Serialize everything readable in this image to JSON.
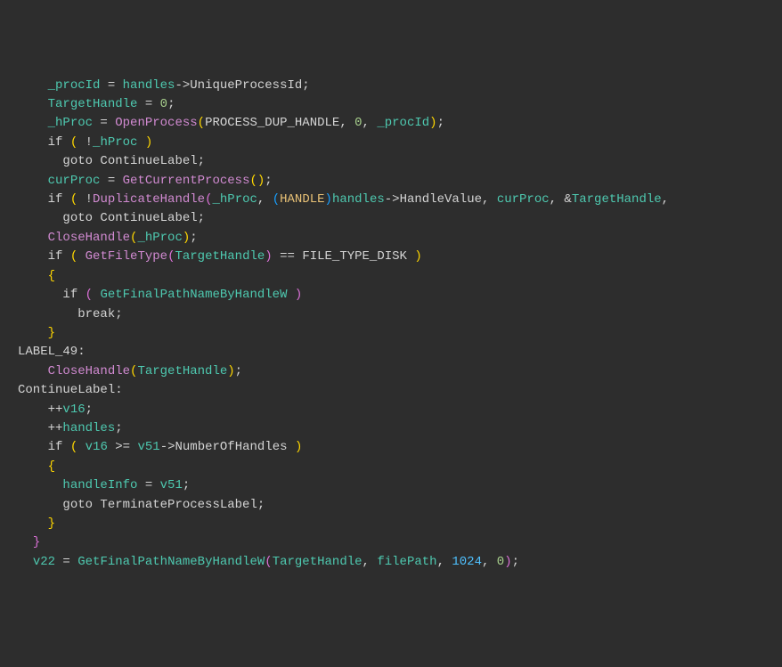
{
  "lines": [
    {
      "ln": "",
      "tokens": [
        [
          "    ",
          "punct"
        ],
        [
          "_procId",
          "var-teal"
        ],
        [
          " = ",
          "punct"
        ],
        [
          "handles",
          "var-teal"
        ],
        [
          "->",
          "punct"
        ],
        [
          "UniqueProcessId",
          ""
        ],
        [
          ";",
          "punct"
        ]
      ]
    },
    {
      "ln": "",
      "tokens": [
        [
          "    ",
          "punct"
        ],
        [
          "TargetHandle",
          "var-teal"
        ],
        [
          " = ",
          "punct"
        ],
        [
          "0",
          "num"
        ],
        [
          ";",
          "punct"
        ]
      ]
    },
    {
      "ln": "",
      "tokens": [
        [
          "    ",
          "punct"
        ],
        [
          "_hProc",
          "var-teal"
        ],
        [
          " = ",
          "punct"
        ],
        [
          "OpenProcess",
          "fn-magenta"
        ],
        [
          "(",
          "bracket-y"
        ],
        [
          "PROCESS_DUP_HANDLE",
          ""
        ],
        [
          ", ",
          "punct"
        ],
        [
          "0",
          "num"
        ],
        [
          ", ",
          "punct"
        ],
        [
          "_procId",
          "var-teal"
        ],
        [
          ")",
          "bracket-y"
        ],
        [
          ";",
          "punct"
        ]
      ]
    },
    {
      "ln": "",
      "tokens": [
        [
          "    ",
          "punct"
        ],
        [
          "if",
          "punct"
        ],
        [
          " ",
          "punct"
        ],
        [
          "(",
          "bracket-y"
        ],
        [
          " !",
          "punct"
        ],
        [
          "_hProc",
          "var-teal"
        ],
        [
          " ",
          "punct"
        ],
        [
          ")",
          "bracket-y"
        ]
      ]
    },
    {
      "ln": "",
      "tokens": [
        [
          "      ",
          "punct"
        ],
        [
          "goto",
          "punct"
        ],
        [
          " ContinueLabel;",
          "punct"
        ]
      ]
    },
    {
      "ln": "",
      "tokens": [
        [
          "    ",
          "punct"
        ],
        [
          "curProc",
          "var-teal"
        ],
        [
          " = ",
          "punct"
        ],
        [
          "GetCurrentProcess",
          "fn-magenta"
        ],
        [
          "(",
          "bracket-y"
        ],
        [
          ")",
          "bracket-y"
        ],
        [
          ";",
          "punct"
        ]
      ]
    },
    {
      "ln": "",
      "tokens": [
        [
          "    ",
          "punct"
        ],
        [
          "if",
          "punct"
        ],
        [
          " ",
          "punct"
        ],
        [
          "(",
          "bracket-y"
        ],
        [
          " !",
          "punct"
        ],
        [
          "DuplicateHandle",
          "fn-magenta"
        ],
        [
          "(",
          "bracket-p"
        ],
        [
          "_hProc",
          "var-teal"
        ],
        [
          ", ",
          "punct"
        ],
        [
          "(",
          "bracket-b"
        ],
        [
          "HANDLE",
          "var-orange"
        ],
        [
          ")",
          "bracket-b"
        ],
        [
          "handles",
          "var-teal"
        ],
        [
          "->",
          "punct"
        ],
        [
          "HandleValue",
          ""
        ],
        [
          ", ",
          "punct"
        ],
        [
          "curProc",
          "var-teal"
        ],
        [
          ", &",
          "punct"
        ],
        [
          "TargetHandle",
          "var-teal"
        ],
        [
          ",",
          "punct"
        ]
      ]
    },
    {
      "ln": "",
      "tokens": [
        [
          "      ",
          "punct"
        ],
        [
          "goto",
          "punct"
        ],
        [
          " ContinueLabel;",
          "punct"
        ]
      ]
    },
    {
      "ln": "",
      "tokens": [
        [
          "    ",
          "punct"
        ],
        [
          "CloseHandle",
          "fn-magenta"
        ],
        [
          "(",
          "bracket-y"
        ],
        [
          "_hProc",
          "var-teal"
        ],
        [
          ")",
          "bracket-y"
        ],
        [
          ";",
          "punct"
        ]
      ]
    },
    {
      "ln": "",
      "tokens": [
        [
          "    ",
          "punct"
        ],
        [
          "if",
          "punct"
        ],
        [
          " ",
          "punct"
        ],
        [
          "(",
          "bracket-y"
        ],
        [
          " ",
          "punct"
        ],
        [
          "GetFileType",
          "fn-magenta"
        ],
        [
          "(",
          "bracket-p"
        ],
        [
          "TargetHandle",
          "var-teal"
        ],
        [
          ")",
          "bracket-p"
        ],
        [
          " == ",
          "punct"
        ],
        [
          "FILE_TYPE_DISK",
          ""
        ],
        [
          " ",
          "punct"
        ],
        [
          ")",
          "bracket-y"
        ]
      ]
    },
    {
      "ln": "",
      "tokens": [
        [
          "    ",
          "punct"
        ],
        [
          "{",
          "bracket-y"
        ]
      ]
    },
    {
      "ln": "",
      "tokens": [
        [
          "      ",
          "punct"
        ],
        [
          "if",
          "punct"
        ],
        [
          " ",
          "punct"
        ],
        [
          "(",
          "bracket-p"
        ],
        [
          " ",
          "punct"
        ],
        [
          "GetFinalPathNameByHandleW",
          "var-teal"
        ],
        [
          " ",
          "punct"
        ],
        [
          ")",
          "bracket-p"
        ]
      ]
    },
    {
      "ln": "",
      "tokens": [
        [
          "        ",
          "punct"
        ],
        [
          "break",
          "punct"
        ],
        [
          ";",
          "punct"
        ]
      ]
    },
    {
      "ln": "",
      "tokens": [
        [
          "    ",
          "punct"
        ],
        [
          "}",
          "bracket-y"
        ]
      ]
    },
    {
      "ln": "",
      "tokens": [
        [
          "LABEL_49:",
          "punct"
        ]
      ]
    },
    {
      "ln": "",
      "tokens": [
        [
          "    ",
          "punct"
        ],
        [
          "CloseHandle",
          "fn-magenta"
        ],
        [
          "(",
          "bracket-y"
        ],
        [
          "TargetHandle",
          "var-teal"
        ],
        [
          ")",
          "bracket-y"
        ],
        [
          ";",
          "punct"
        ]
      ]
    },
    {
      "ln": "",
      "tokens": [
        [
          "ContinueLabel:",
          "punct"
        ]
      ]
    },
    {
      "ln": "",
      "tokens": [
        [
          "    ++",
          "punct"
        ],
        [
          "v16",
          "var-teal"
        ],
        [
          ";",
          "punct"
        ]
      ]
    },
    {
      "ln": "",
      "tokens": [
        [
          "    ++",
          "punct"
        ],
        [
          "handles",
          "var-teal"
        ],
        [
          ";",
          "punct"
        ]
      ]
    },
    {
      "ln": "",
      "tokens": [
        [
          "    ",
          "punct"
        ],
        [
          "if",
          "punct"
        ],
        [
          " ",
          "punct"
        ],
        [
          "(",
          "bracket-y"
        ],
        [
          " ",
          "punct"
        ],
        [
          "v16",
          "var-teal"
        ],
        [
          " >= ",
          "punct"
        ],
        [
          "v51",
          "var-teal"
        ],
        [
          "->",
          "punct"
        ],
        [
          "NumberOfHandles",
          ""
        ],
        [
          " ",
          "punct"
        ],
        [
          ")",
          "bracket-y"
        ]
      ]
    },
    {
      "ln": "",
      "tokens": [
        [
          "    ",
          "punct"
        ],
        [
          "{",
          "bracket-y"
        ]
      ]
    },
    {
      "ln": "",
      "tokens": [
        [
          "      ",
          "punct"
        ],
        [
          "handleInfo",
          "var-teal"
        ],
        [
          " = ",
          "punct"
        ],
        [
          "v51",
          "var-teal"
        ],
        [
          ";",
          "punct"
        ]
      ]
    },
    {
      "ln": "",
      "tokens": [
        [
          "      ",
          "punct"
        ],
        [
          "goto",
          "punct"
        ],
        [
          " TerminateProcessLabel;",
          "punct"
        ]
      ]
    },
    {
      "ln": "",
      "tokens": [
        [
          "    ",
          "punct"
        ],
        [
          "}",
          "bracket-y"
        ]
      ]
    },
    {
      "ln": "",
      "tokens": [
        [
          "  ",
          "punct"
        ],
        [
          "}",
          "bracket-p"
        ]
      ]
    },
    {
      "ln": "",
      "tokens": [
        [
          "  ",
          "punct"
        ],
        [
          "v22",
          "var-teal"
        ],
        [
          " = ",
          "punct"
        ],
        [
          "GetFinalPathNameByHandleW",
          "var-teal"
        ],
        [
          "(",
          "bracket-p"
        ],
        [
          "TargetHandle",
          "var-teal"
        ],
        [
          ", ",
          "punct"
        ],
        [
          "filePath",
          "var-teal"
        ],
        [
          ", ",
          "punct"
        ],
        [
          "1024",
          "num-cyan"
        ],
        [
          ", ",
          "punct"
        ],
        [
          "0",
          "num"
        ],
        [
          ")",
          "bracket-p"
        ],
        [
          ";",
          "punct"
        ]
      ]
    }
  ]
}
